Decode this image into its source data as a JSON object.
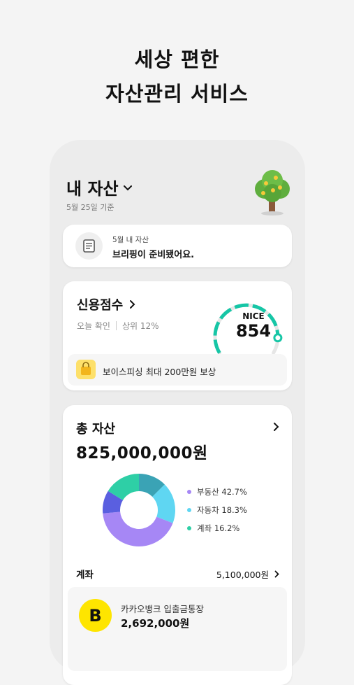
{
  "headline": {
    "line1": "세상 편한",
    "line2": "자산관리 서비스"
  },
  "header": {
    "title": "내 자산",
    "date": "5월 25일 기준"
  },
  "briefing": {
    "subtitle": "5월 내 자산",
    "message": "브리핑이 준비됐어요."
  },
  "credit": {
    "title": "신용점수",
    "check_label": "오늘 확인",
    "rank_label": "상위 12%",
    "agency": "NICE",
    "score": "854",
    "score_value": 854,
    "phishing_text": "보이스피싱 최대 200만원 보상"
  },
  "assets": {
    "title": "총 자산",
    "total": "825,000,000원",
    "legend": [
      {
        "label": "부동산 42.7%",
        "color": "#a687f5"
      },
      {
        "label": "자동차 18.3%",
        "color": "#5fd6f2"
      },
      {
        "label": "계좌 16.2%",
        "color": "#2ecfa6"
      }
    ],
    "account_label": "계좌",
    "account_total": "5,100,000원",
    "bank": {
      "logo": "B",
      "name": "카카오뱅크 입출금통장",
      "balance": "2,692,000원"
    }
  },
  "chart_data": {
    "type": "pie",
    "categories": [
      "부동산",
      "자동차",
      "계좌"
    ],
    "values": [
      42.7,
      18.3,
      16.2
    ]
  },
  "icons": [
    "chevron-down-icon",
    "tree-icon",
    "document-icon",
    "chevron-right-icon",
    "shopping-bag-icon"
  ]
}
